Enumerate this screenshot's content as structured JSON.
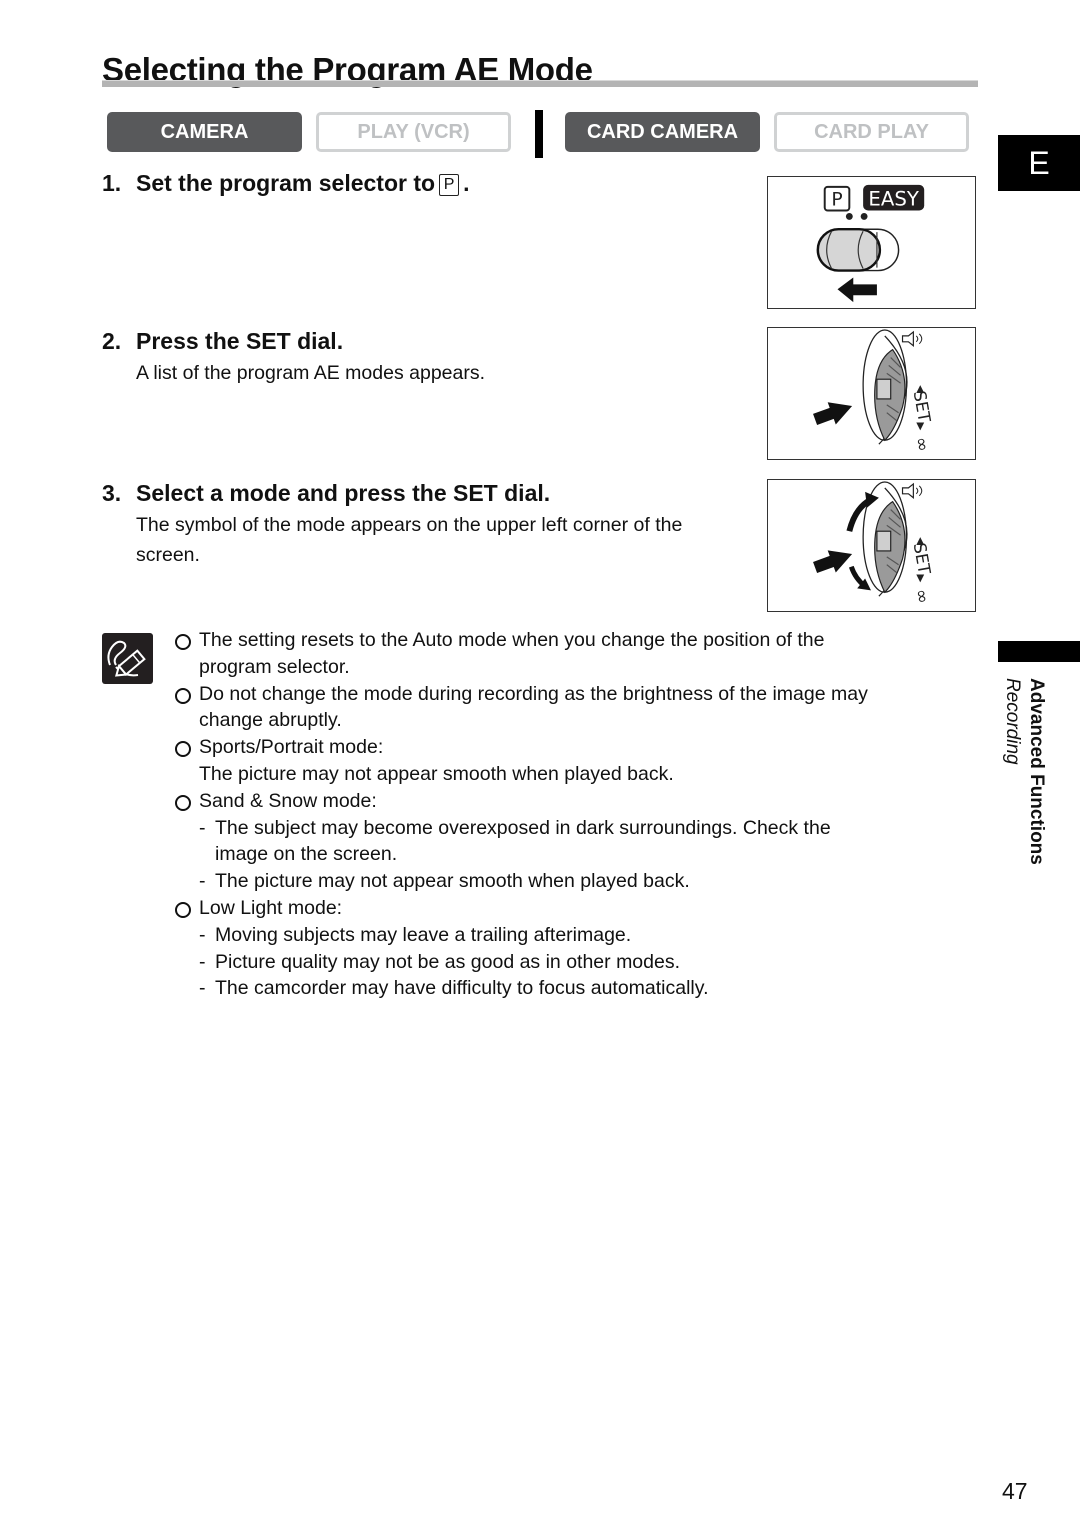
{
  "page": {
    "title": "Selecting the Program AE Mode",
    "language_tab": "E",
    "page_number": "47"
  },
  "mode_tabs": [
    {
      "label": "CAMERA",
      "active": true
    },
    {
      "label": "PLAY (VCR)",
      "active": false
    },
    {
      "label": "CARD CAMERA",
      "active": true
    },
    {
      "label": "CARD PLAY",
      "active": false
    }
  ],
  "steps": [
    {
      "number": "1.",
      "title": "Set the program selector to",
      "symbol": "P",
      "suffix": ".",
      "body": ""
    },
    {
      "number": "2.",
      "title": "Press the SET dial.",
      "body": "A list of the program AE modes appears."
    },
    {
      "number": "3.",
      "title": "Select a mode and press the SET dial.",
      "body_line1": "The symbol of the mode appears on the upper left corner of the",
      "body_line2": "screen."
    }
  ],
  "illustrations": {
    "selector": {
      "label_p": "P",
      "label_easy": "EASY"
    },
    "dial": {
      "label_set": "SET"
    }
  },
  "notes": {
    "icon": "pencil-note-icon",
    "items": [
      {
        "lines": [
          "The setting resets to the Auto mode when you change the position of the",
          "program selector."
        ]
      },
      {
        "lines": [
          "Do not change the mode during recording as the brightness of the image may",
          "change abruptly."
        ]
      },
      {
        "lines": [
          "Sports/Portrait mode:",
          "The picture may not appear smooth when played back."
        ]
      },
      {
        "lines": [
          "Sand & Snow mode:"
        ],
        "sub": [
          [
            "The subject may become overexposed in dark surroundings. Check the",
            "image on the screen."
          ],
          [
            "The picture may not appear smooth when played back."
          ]
        ]
      },
      {
        "lines": [
          "Low Light mode:"
        ],
        "sub": [
          [
            "Moving subjects may leave a trailing afterimage."
          ],
          [
            "Picture quality may not be as good as in other modes."
          ],
          [
            "The camcorder may have difficulty to focus automatically."
          ]
        ]
      }
    ],
    "dash": "-"
  },
  "side_index": {
    "section": "Advanced Functions",
    "subsection": "Recording"
  }
}
